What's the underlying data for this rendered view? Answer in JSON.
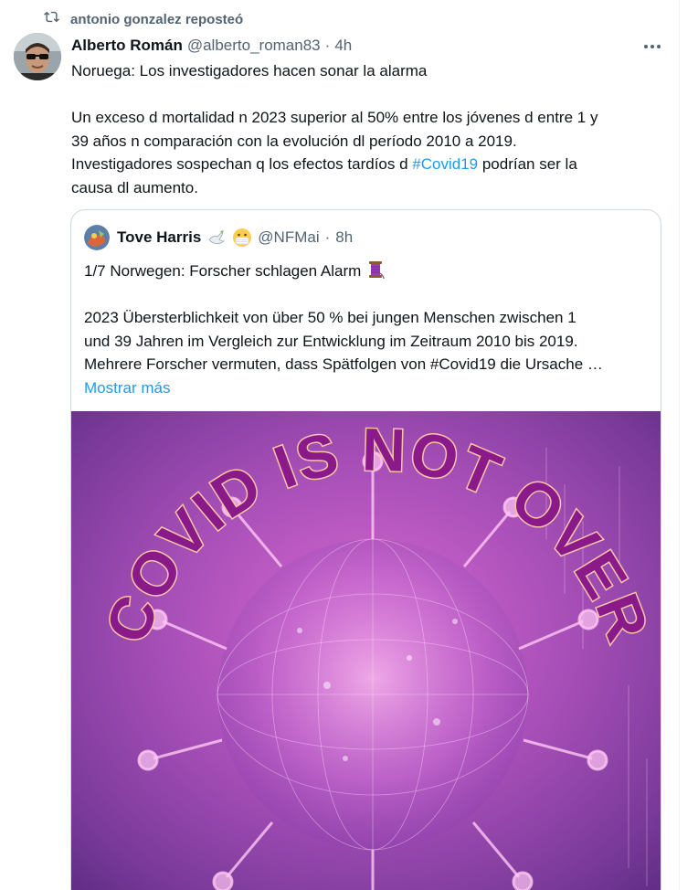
{
  "retweet": {
    "text": "antonio gonzalez reposteó",
    "icon": "retweet-icon"
  },
  "tweet": {
    "author_name": "Alberto Román",
    "author_handle": "@alberto_roman83",
    "separator": "·",
    "time": "4h",
    "more_icon": "more-horizontal-icon",
    "line1": "Noruega: Los investigadores hacen sonar la alarma",
    "para2_line1": "Un exceso d mortalidad n 2023 superior al 50% entre los jóvenes d entre 1 y",
    "para2_line2": "39 años n comparación con la evolución dl período 2010 a 2019.",
    "para2_line3": "Investigadores sospechan q los efectos tardíos d ",
    "hashtag": "#Covid19",
    "para2_line3_end": " podrían ser la",
    "para2_line4": "causa dl aumento."
  },
  "quote": {
    "author_name": "Tove Harris",
    "author_handle": "@NFMai",
    "separator": "·",
    "time": "8h",
    "emoji_names": [
      "dove-emoji",
      "mask-emoji",
      "thread-spool-emoji"
    ],
    "line1": "1/7 Norwegen: Forscher schlagen Alarm ",
    "para2_line1": "2023 Übersterblichkeit von über 50 % bei jungen Menschen zwischen 1",
    "para2_line2": "und 39 Jahren im Vergleich zur Entwicklung im Zeitraum 2010 bis 2019.",
    "para2_line3": "Mehrere Forscher vermuten, dass Spätfolgen von #Covid19 die Ursache …",
    "show_more": "Mostrar más",
    "image_caption": "COVID IS NOT OVER"
  },
  "colors": {
    "link": "#1d9bf0",
    "text": "#0f1419",
    "secondary": "#536471",
    "border": "#cfd9de",
    "caption_fill": "#8a1a8a",
    "caption_stroke": "#f6c6a6"
  }
}
